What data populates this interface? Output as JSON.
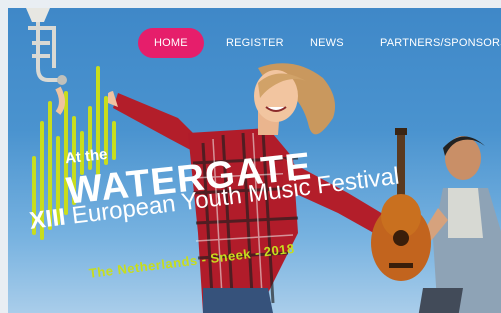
{
  "nav": {
    "items": [
      {
        "label": "HOME",
        "active": true
      },
      {
        "label": "REGISTER",
        "active": false
      },
      {
        "label": "NEWS",
        "active": false
      },
      {
        "label": "PARTNERS/SPONSORS",
        "active": false
      }
    ]
  },
  "hero": {
    "logo_small": "At the",
    "logo_big": "WATERGATE",
    "subtitle_numeral": "XIII",
    "subtitle_text": "European Youth Music Festival",
    "tagline": "The Netherlands - Sneek - 2018"
  },
  "colors": {
    "accent": "#e61e6b",
    "lime": "#c8dd1d",
    "sky": "#4a93cf"
  },
  "icons": {
    "trumpet": "trumpet-illustration",
    "guitar": "guitar-illustration"
  }
}
